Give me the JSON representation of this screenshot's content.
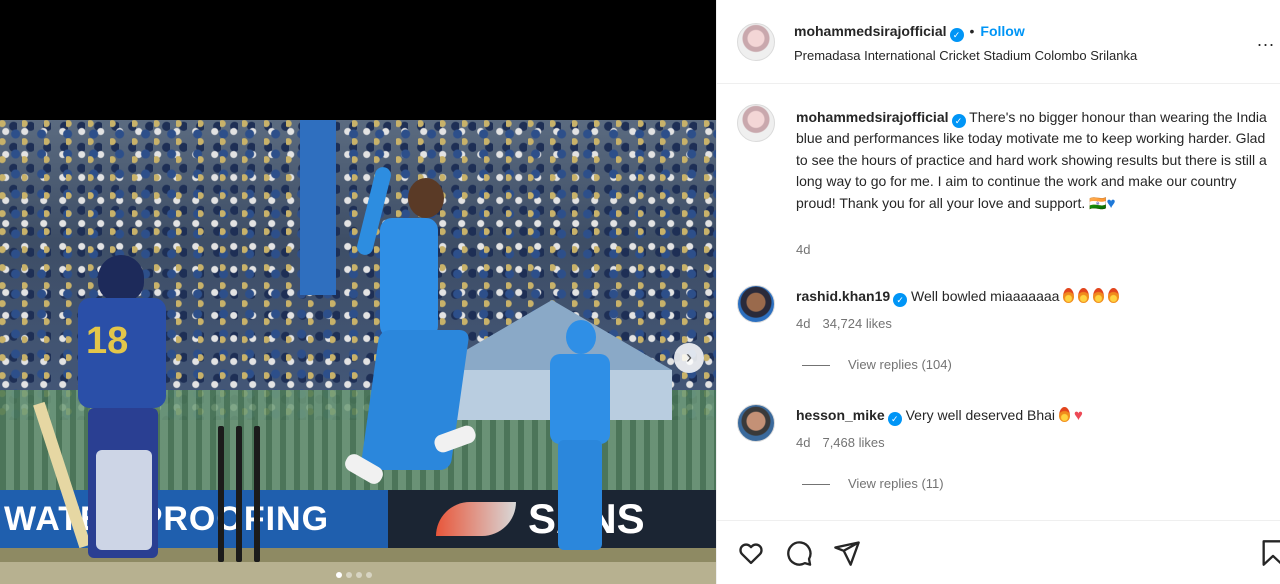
{
  "post": {
    "username": "mohammedsirajofficial",
    "separator": "•",
    "follow_label": "Follow",
    "location": "Premadasa International Cricket Stadium Colombo Srilanka",
    "more_label": "...",
    "caption": "There's no bigger honour than wearing the India blue and performances like today motivate me to keep working harder. Glad to see the hours of practice and hard work showing results but there is still a long way to go for me. I aim to continue the work and make our country proud! Thank you for all your love and support. 🇮🇳",
    "caption_time": "4d",
    "verified_icon": "check-badge-icon"
  },
  "media": {
    "banner_left": "WATER PROOFING",
    "banner_right": "SANS",
    "jersey_number": "18",
    "carousel_dots": 4,
    "active_dot": 0,
    "next_arrow": "›"
  },
  "comments": [
    {
      "username": "rashid.khan19",
      "text": "Well bowled miaaaaaaa",
      "emoji": "fire-icon-x4",
      "time": "4d",
      "likes": "34,724 likes",
      "replies": "View replies (104)"
    },
    {
      "username": "hesson_mike",
      "text": "Very well deserved Bhai",
      "emoji": "fire-and-red-heart",
      "time": "4d",
      "likes": "7,468 likes",
      "replies": "View replies (11)"
    }
  ],
  "actions": {
    "like": "heart-outline-icon",
    "comment": "comment-bubble-icon",
    "share": "paper-plane-icon",
    "save": "bookmark-icon"
  },
  "colors": {
    "link": "#0095f6",
    "text": "#262626",
    "muted": "#737373",
    "india_blue": "#2f8fe6"
  }
}
